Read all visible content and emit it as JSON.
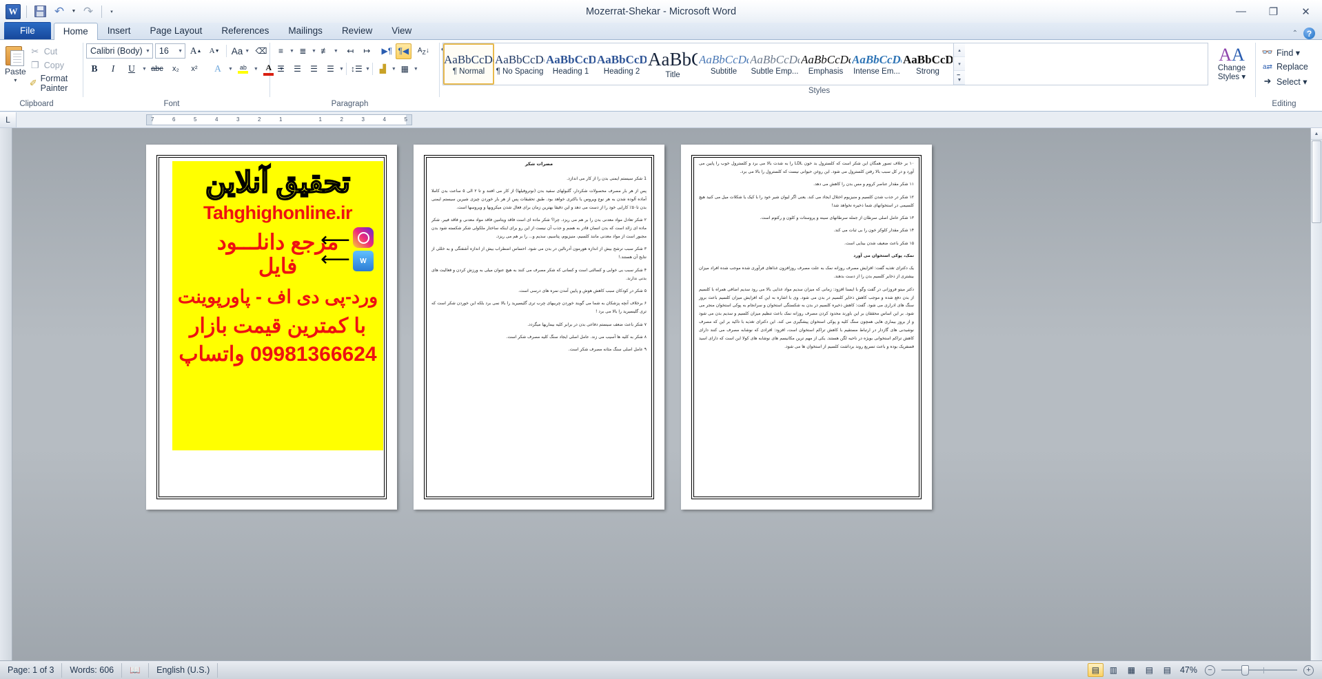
{
  "window": {
    "title": "Mozerrat-Shekar  -  Microsoft Word",
    "app_logo": "word-logo",
    "minimize": "—",
    "restore": "❐",
    "close": "✕"
  },
  "quick_access": {
    "save": "save-icon",
    "undo": "↺",
    "undo_caret": "▾",
    "redo": "↻",
    "customize_caret": "▾"
  },
  "tabs": [
    {
      "label": "File",
      "active": false,
      "file": true
    },
    {
      "label": "Home",
      "active": true
    },
    {
      "label": "Insert",
      "active": false
    },
    {
      "label": "Page Layout",
      "active": false
    },
    {
      "label": "References",
      "active": false
    },
    {
      "label": "Mailings",
      "active": false
    },
    {
      "label": "Review",
      "active": false
    },
    {
      "label": "View",
      "active": false
    }
  ],
  "help": {
    "collapse_caret": "⌃",
    "help": "?"
  },
  "ribbon": {
    "clipboard": {
      "label": "Clipboard",
      "paste": "Paste",
      "paste_caret": "▾",
      "cut": "Cut",
      "copy": "Copy",
      "format_painter": "Format Painter",
      "cut_icon": "scissors-icon",
      "copy_icon": "copy-icon",
      "painter_icon": "paintbrush-icon"
    },
    "font": {
      "label": "Font",
      "font_name": "Calibri (Body)",
      "font_size": "16",
      "grow": "A",
      "shrink": "A",
      "change_case": "Aa",
      "clear_formatting": "clear-formatting-icon",
      "bold": "B",
      "italic": "I",
      "underline": "U",
      "strikethrough": "abc",
      "subscript": "x₂",
      "superscript": "x²",
      "text_effects": "A",
      "highlight": "ab",
      "font_color": "A"
    },
    "paragraph": {
      "label": "Paragraph",
      "bullets": "bullets-icon",
      "numbering": "numbering-icon",
      "multilevel": "multilevel-list-icon",
      "decrease_indent": "decrease-indent-icon",
      "increase_indent": "increase-indent-icon",
      "ltr": "ltr-icon",
      "rtl": "rtl-icon",
      "sort": "sort-icon",
      "show_marks": "¶",
      "align_left": "align-left-icon",
      "align_center": "align-center-icon",
      "align_right": "align-right-icon",
      "justify": "justify-icon",
      "line_spacing": "line-spacing-icon",
      "shading": "shading-icon",
      "borders": "borders-icon"
    },
    "styles": {
      "label": "Styles",
      "items": [
        {
          "preview": "AaBbCcDdEe",
          "name": "¶ Normal",
          "selected": true
        },
        {
          "preview": "AaBbCcDdEe",
          "name": "¶ No Spacing",
          "selected": false
        },
        {
          "preview": "AaBbCcDdEe",
          "name": "Heading 1",
          "selected": false
        },
        {
          "preview": "AaBbCcDdEe",
          "name": "Heading 2",
          "selected": false
        },
        {
          "preview": "AaBbCcDdEe",
          "name": "Title",
          "selected": false
        },
        {
          "preview": "AaBbCcDdEe",
          "name": "Subtitle",
          "selected": false
        },
        {
          "preview": "AaBbCcDdEe",
          "name": "Subtle Emp...",
          "selected": false
        },
        {
          "preview": "AaBbCcDdEe",
          "name": "Emphasis",
          "selected": false
        },
        {
          "preview": "AaBbCcDdEe",
          "name": "Intense Em...",
          "selected": false
        },
        {
          "preview": "AaBbCcDdEe",
          "name": "Strong",
          "selected": false
        }
      ],
      "scroll_up": "▴",
      "scroll_down": "▾",
      "more": "▾"
    },
    "change_styles": {
      "line1": "Change",
      "line2": "Styles ▾",
      "icon": "AA"
    },
    "editing": {
      "label": "Editing",
      "find": "Find ▾",
      "replace": "Replace",
      "select": "Select ▾",
      "find_icon": "binoculars-icon",
      "replace_icon": "replace-icon",
      "select_icon": "cursor-icon"
    }
  },
  "ruler": {
    "tab_selector": "L",
    "marks": [
      "7",
      "6",
      "5",
      "4",
      "3",
      "2",
      "1",
      "",
      "1",
      "2",
      "3",
      "4",
      "5"
    ]
  },
  "document": {
    "page1": {
      "ad": {
        "title": "تحقیق آنلاین",
        "url": "Tahghighonline.ir",
        "line1": "مرجع دانلـــود",
        "line2": "فایل",
        "line3": "ورد-پی دی اف - پاورپوینت",
        "line4": "با کمترین قیمت بازار",
        "line5": "09981366624 واتساپ",
        "instagram_icon": "instagram-icon",
        "whatsapp_icon": "whatsapp-icon",
        "arrow_icon": "arrow-left-icon"
      }
    },
    "page2": {
      "heading": "مضرات شکر",
      "paragraphs": [
        "1  شکر سیستم ایمنی بدن را از کار می اندازد.",
        "پس از هر بار مصرف محصولات شکردار، گلبولهای سفید بدن (نوتروفیلها) از کار می افتند و تا ۲ الی ۵ ساعت بدن کاملا آماده آلوده شدن به هر نوع ویروس یا باکتری خواهد بود. طبق تحقیقات پس از هر بار خوردن چیزی شیرین سیستم ایمنی بدن تا۵۰٪ کارایی خود را از دست می دهد و این دقیقا بهترین زمان برای فعال شدن میکروبها و ویروسها است.",
        "۲ شکر تعادل مواد معدنی بدن را بر هم می ریزد. چرا؟ شکر ماده ای است فاقد ویتامین  فاقد مواد معدنی و فاقد فیبر. شکر ماده ای زائد است که بدن انسان قادر به هضم و جذب آن نیست از این رو برای اینکه ساختار ملکولی شکر شکسته شود بدن مجبور است از مواد معدنی مانند کلسیم، منیزیوم،  پتاسیم، سدیم و... را بر هم می ریزد.",
        "۳ شکر سبب ترشح بیش از اندازه هورمون آدرنالین در بدن می شود. احساس اضطراب بیش از اندازه آشفتگی و به خللی از نتایج آن هستند.!",
        "۴ شکر سبب بی خوابی و کسالتی است و کسانی که شکر مصرف می کنند به هیچ عنوان میلی به ورزش کردن و فعالیت های بدنی ندارند.",
        "۵ شکر در کودکان سبب کاهش هوش و پایین آمدن نمره های درسی است.",
        "۶ برخلاف آنچه پزشکان به شما می گویند خوردن چربیهای چرب تری گلیسیرید را بالا نمی برد بلکه این خوردن شکر است که تری گلیسیرید را بالا می برد !",
        "۷ شکر باعث ضعف سیستم دفاعی بدن در برابر کلیه بیماریها میگردد.",
        "۸ شکر به کلیه ها آسیب می زند. عامل اصلی ایجاد سنگ کلیه مصرف شکر است.",
        "۹  عامل اصلی سنگ مثانه مصرف شکر است."
      ]
    },
    "page3": {
      "paragraphs": [
        "۱۰ بر خلاف تصور همگان این شکر است که کلسترول بد خون LDL را به شدت بالا می برد و کلسترول خوب را پایین می آورد و در کل سبب بالا رفتن کلسترول می شود. این روغن حیوانی نیست که کلسترول را بالا می برد.",
        "۱۱ شکر مقدار عناصر کروم و مس بدن را کاهش می دهد.",
        "۱۲ شکر در جذب شدن کلسیم و منیزیوم اختلال ایجاد می کند. یعنی اگر لیوان شیر خود را با کیک یا شکلات میل می کنید هیچ کلسیمی در استخوانهای شما ذخیره نخواهد شد!",
        "۱۳ شکر عامل اصلی سرطان از جمله سرطانهای سینه و پروستات و کلون و رکتوم است.",
        "۱۴ شکر مقدار کلوکز خون را بی ثبات می کند.",
        "۱۵ شکر باعث ضعیف شدن بینایی است.",
        "نمک، پوکی استخوان  می آورد",
        "یک دکترای تغذیه گفت: افزایش مصرف روزانه نمک به علت مصرف روزافزون غذاهای فرآوری شده موجب شده افراد میزان بیشتری از ذخایر کلسیم بدن را از دست بدهند.",
        "دکتر میتو فروزانی در گفت وگو با ایسنا افزود: زمانی که میزان سدیم مواد غذایی بالا می رود سدیم اضافی همراه با کلسیم از بدن دفع شده و موجب کاهش ذخایر کلسیم در بدن می شود. وی با اشاره به این که افزایش میزان کلسیم باعث بروز سنگ های ادراری می شود. گفت: کاهش ذخیره کلسیم در بدن به شکستگی استخوان و سرانجام به پوکی استخوان منجر می شود. بر این اساس محققان بر این باورند محدود کردن مصرف روزانه نمک باعث تنظیم میزان کلسیم و سدیم بدن می شود و از بروز بیماری هایی همچون سنگ کلیه و پوکی استخوان پیشگیری می کند. این دکترای تغذیه با تاکید بر این که مصرف نوشیدنی های گازدار در ارتباط مستقیم با کاهش تراکم استخوان است، افزود: افرادی که نوشابه مصرف می کنند دارای کاهش تراکم استخوانی بویژه در ناحیه لگن هستند. یکی از مهم ترین مکانیسم های نوشابه های کولا این است که دارای اسید فسفریک بوده و باعث تسریع روند برداشت کلسیم از استخوان ها می شود."
      ]
    }
  },
  "status_bar": {
    "page": "Page: 1 of 3",
    "words": "Words: 606",
    "proofing_icon": "spellcheck-icon",
    "language": "English (U.S.)",
    "views": [
      {
        "name": "print-layout",
        "icon": "▤",
        "active": true
      },
      {
        "name": "full-screen-reading",
        "icon": "▥",
        "active": false
      },
      {
        "name": "web-layout",
        "icon": "▦",
        "active": false
      },
      {
        "name": "outline",
        "icon": "▤",
        "active": false
      },
      {
        "name": "draft",
        "icon": "▤",
        "active": false
      }
    ],
    "zoom": "47%",
    "zoom_out": "−",
    "zoom_in": "+"
  }
}
